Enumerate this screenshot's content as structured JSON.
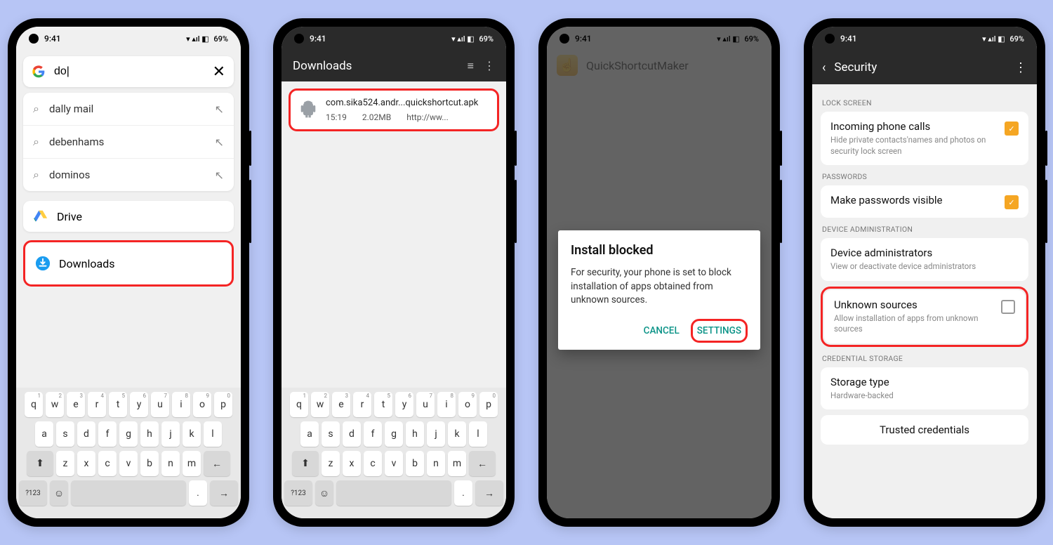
{
  "status": {
    "time": "9:41",
    "battery": "69%",
    "signal": "▾ ▴ıl ◧"
  },
  "p1": {
    "search": "do|",
    "suggestions": [
      "dally mail",
      "debenhams",
      "dominos"
    ],
    "apps": {
      "drive": "Drive",
      "downloads": "Downloads"
    }
  },
  "p2": {
    "header": "Downloads",
    "file": {
      "name": "com.sika524.andr...quickshortcut.apk",
      "time": "15:19",
      "size": "2.02MB",
      "src": "http://ww..."
    }
  },
  "p3": {
    "app_title": "QuickShortcutMaker",
    "dialog": {
      "title": "Install blocked",
      "body": "For security, your phone is set to block installation of apps obtained from unknown sources.",
      "cancel": "CANCEL",
      "settings": "SETTINGS"
    }
  },
  "p4": {
    "header": "Security",
    "sections": {
      "lock": "LOCK SCREEN",
      "passwords": "PASSWORDS",
      "admin": "DEVICE ADMINISTRATION",
      "cred": "CREDENTIAL STORAGE"
    },
    "items": {
      "calls_t": "Incoming phone calls",
      "calls_s": "Hide private contacts'names and photos on security lock screen",
      "pw_t": "Make passwords visible",
      "da_t": "Device administrators",
      "da_s": "View or deactivate device administrators",
      "us_t": "Unknown sources",
      "us_s": "Allow installation of apps from unknown sources",
      "st_t": "Storage type",
      "st_s": "Hardware-backed",
      "tc_t": "Trusted credentials"
    }
  },
  "keyboard": {
    "r1": [
      "q",
      "w",
      "e",
      "r",
      "t",
      "y",
      "u",
      "i",
      "o",
      "p"
    ],
    "r2": [
      "a",
      "s",
      "d",
      "f",
      "g",
      "h",
      "j",
      "k",
      "l"
    ],
    "r3": [
      "z",
      "x",
      "c",
      "v",
      "b",
      "n",
      "m"
    ],
    "nums": "?123"
  }
}
